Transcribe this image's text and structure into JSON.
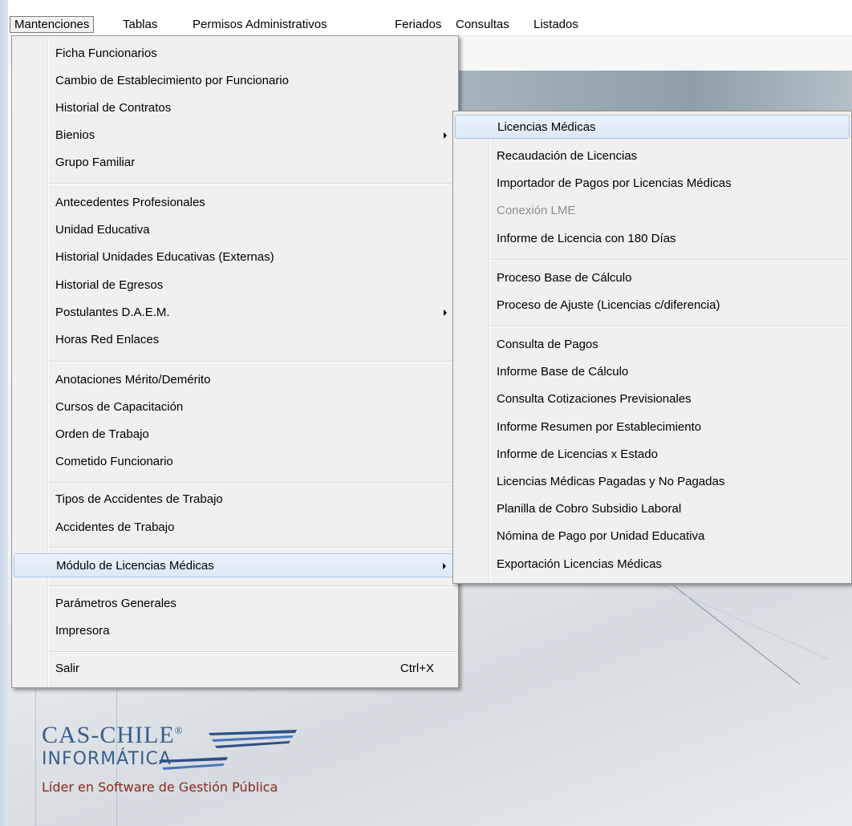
{
  "menubar": {
    "items": [
      {
        "label": "Mantenciones"
      },
      {
        "label": "Tablas"
      },
      {
        "label": "Permisos Administrativos"
      },
      {
        "label": "Feriados"
      },
      {
        "label": "Consultas"
      },
      {
        "label": "Listados"
      }
    ]
  },
  "main_menu": {
    "items": [
      {
        "label": "Ficha Funcionarios"
      },
      {
        "label": "Cambio de Establecimiento por Funcionario"
      },
      {
        "label": "Historial de Contratos"
      },
      {
        "label": "Bienios"
      },
      {
        "label": "Grupo Familiar"
      },
      {
        "label": "Antecedentes Profesionales"
      },
      {
        "label": "Unidad Educativa"
      },
      {
        "label": "Historial Unidades Educativas (Externas)"
      },
      {
        "label": "Historial de Egresos"
      },
      {
        "label": "Postulantes D.A.E.M."
      },
      {
        "label": "Horas Red Enlaces"
      },
      {
        "label": "Anotaciones Mérito/Demérito"
      },
      {
        "label": "Cursos de Capacitación"
      },
      {
        "label": "Orden de Trabajo"
      },
      {
        "label": "Cometido Funcionario"
      },
      {
        "label": "Tipos de Accidentes de Trabajo"
      },
      {
        "label": "Accidentes de Trabajo"
      },
      {
        "label": "Módulo de Licencias Médicas"
      },
      {
        "label": "Parámetros Generales"
      },
      {
        "label": "Impresora"
      },
      {
        "label": "Salir",
        "shortcut": "Ctrl+X"
      }
    ]
  },
  "submenu": {
    "items": [
      {
        "label": "Licencias Médicas"
      },
      {
        "label": "Recaudación de Licencias"
      },
      {
        "label": "Importador de Pagos por Licencias Médicas"
      },
      {
        "label": "Conexión LME"
      },
      {
        "label": "Informe de Licencia con 180 Días"
      },
      {
        "label": "Proceso Base de Cálculo"
      },
      {
        "label": "Proceso de Ajuste (Licencias c/diferencia)"
      },
      {
        "label": "Consulta de Pagos"
      },
      {
        "label": "Informe Base de Cálculo"
      },
      {
        "label": "Consulta Cotizaciones Previsionales"
      },
      {
        "label": "Informe Resumen por Establecimiento"
      },
      {
        "label": "Informe de Licencias x Estado"
      },
      {
        "label": "Licencias Médicas Pagadas y No Pagadas"
      },
      {
        "label": "Planilla de Cobro Subsidio Laboral"
      },
      {
        "label": "Nómina de Pago por Unidad Educativa"
      },
      {
        "label": "Exportación Licencias Médicas"
      }
    ]
  },
  "logo": {
    "name": "CAS-CHILE",
    "mark": "®",
    "sub": "INFORMÁTICA",
    "tagline": "Líder en Software de Gestión Pública"
  }
}
